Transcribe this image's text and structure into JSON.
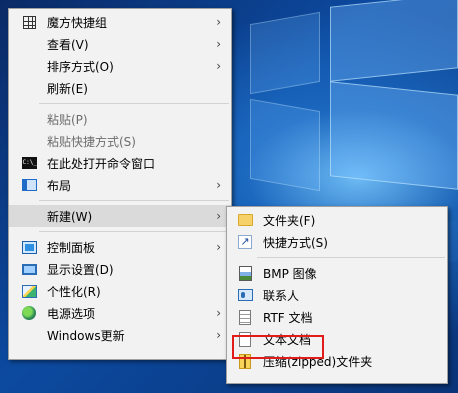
{
  "context_menu": {
    "items": [
      {
        "label": "魔方快捷组",
        "icon": "grid-icon",
        "submenu": true
      },
      {
        "label": "查看(V)",
        "submenu": true
      },
      {
        "label": "排序方式(O)",
        "submenu": true
      },
      {
        "label": "刷新(E)"
      },
      {
        "label": "粘贴(P)",
        "disabled": true
      },
      {
        "label": "粘贴快捷方式(S)",
        "disabled": true
      },
      {
        "label": "在此处打开命令窗口",
        "icon": "command-prompt-icon"
      },
      {
        "label": "布局",
        "icon": "layout-icon",
        "submenu": true
      },
      {
        "label": "新建(W)",
        "submenu": true,
        "active": true
      },
      {
        "label": "控制面板",
        "icon": "control-panel-icon",
        "submenu": true
      },
      {
        "label": "显示设置(D)",
        "icon": "display-icon"
      },
      {
        "label": "个性化(R)",
        "icon": "personalize-icon"
      },
      {
        "label": "电源选项",
        "icon": "power-icon",
        "submenu": true
      },
      {
        "label": "Windows更新",
        "submenu": true
      }
    ]
  },
  "new_submenu": {
    "items": [
      {
        "label": "文件夹(F)",
        "icon": "folder-icon"
      },
      {
        "label": "快捷方式(S)",
        "icon": "shortcut-icon"
      },
      {
        "label": "BMP 图像",
        "icon": "bitmap-icon"
      },
      {
        "label": "联系人",
        "icon": "contact-icon"
      },
      {
        "label": "RTF 文档",
        "icon": "rtf-document-icon"
      },
      {
        "label": "文本文档",
        "icon": "text-document-icon",
        "highlighted": true
      },
      {
        "label": "压缩(zipped)文件夹",
        "icon": "zip-folder-icon"
      }
    ]
  },
  "glyphs": {
    "arrow": "›",
    "cmd": "C:\\_",
    "shortcut": "↗"
  },
  "colors": {
    "highlight": "#e21b1b",
    "menu_bg": "#f2f2f2",
    "active_bg": "#dadada"
  }
}
